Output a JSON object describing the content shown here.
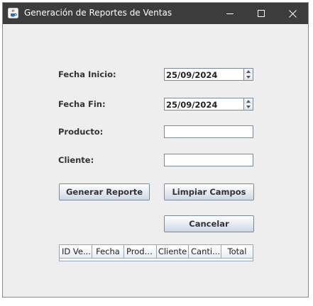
{
  "window": {
    "title": "Generación de Reportes de Ventas",
    "icon": "java-cup-icon"
  },
  "form": {
    "fecha_inicio": {
      "label": "Fecha Inicio:",
      "value": "25/09/2024"
    },
    "fecha_fin": {
      "label": "Fecha Fin:",
      "value": "25/09/2024"
    },
    "producto": {
      "label": "Producto:",
      "value": ""
    },
    "cliente": {
      "label": "Cliente:",
      "value": ""
    }
  },
  "buttons": {
    "generar": "Generar Reporte",
    "limpiar": "Limpiar Campos",
    "cancelar": "Cancelar"
  },
  "table": {
    "headers": [
      "ID Ve...",
      "Fecha",
      "Produ...",
      "Cliente",
      "Canti...",
      "Total"
    ],
    "rows": []
  },
  "colors": {
    "titlebar": "#3c3c3c",
    "window_bg": "#eeeeee"
  }
}
